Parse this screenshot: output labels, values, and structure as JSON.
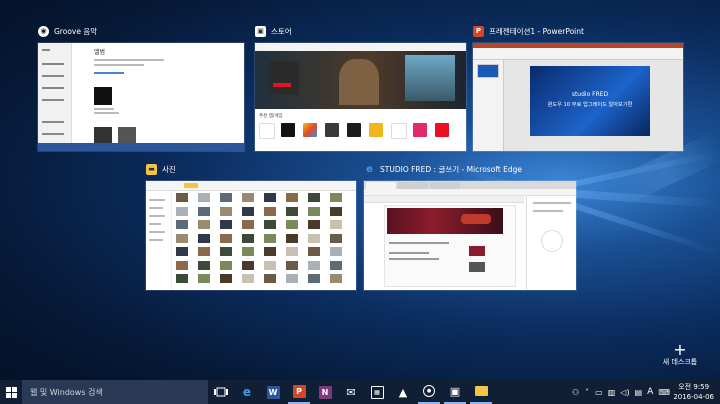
{
  "windows": {
    "groove": {
      "title": "Groove 음악",
      "heading": "앨범"
    },
    "store": {
      "title": "스토어",
      "section": "추천 앱/게임"
    },
    "powerpoint": {
      "title": "프레젠테이션1 - PowerPoint",
      "slide_line1": "studio FRED",
      "slide_line2": "윈도우 10 무료 업그레이드 알아보기편"
    },
    "photos": {
      "title": "사진"
    },
    "edge": {
      "title": "STUDIO FRED : 글쓰기 - Microsoft Edge"
    }
  },
  "new_desktop": {
    "label": "새 데스크톱"
  },
  "taskbar": {
    "search_placeholder": "웹 및 Windows 검색",
    "input_indicator": "A",
    "time": "오전 9:59",
    "date": "2016-04-06",
    "pinned_icons": [
      "edge-icon",
      "word-icon",
      "powerpoint-icon",
      "onenote-icon",
      "mail-icon",
      "calendar-icon",
      "photos-icon",
      "groove-icon",
      "store-icon",
      "file-explorer-icon"
    ]
  }
}
